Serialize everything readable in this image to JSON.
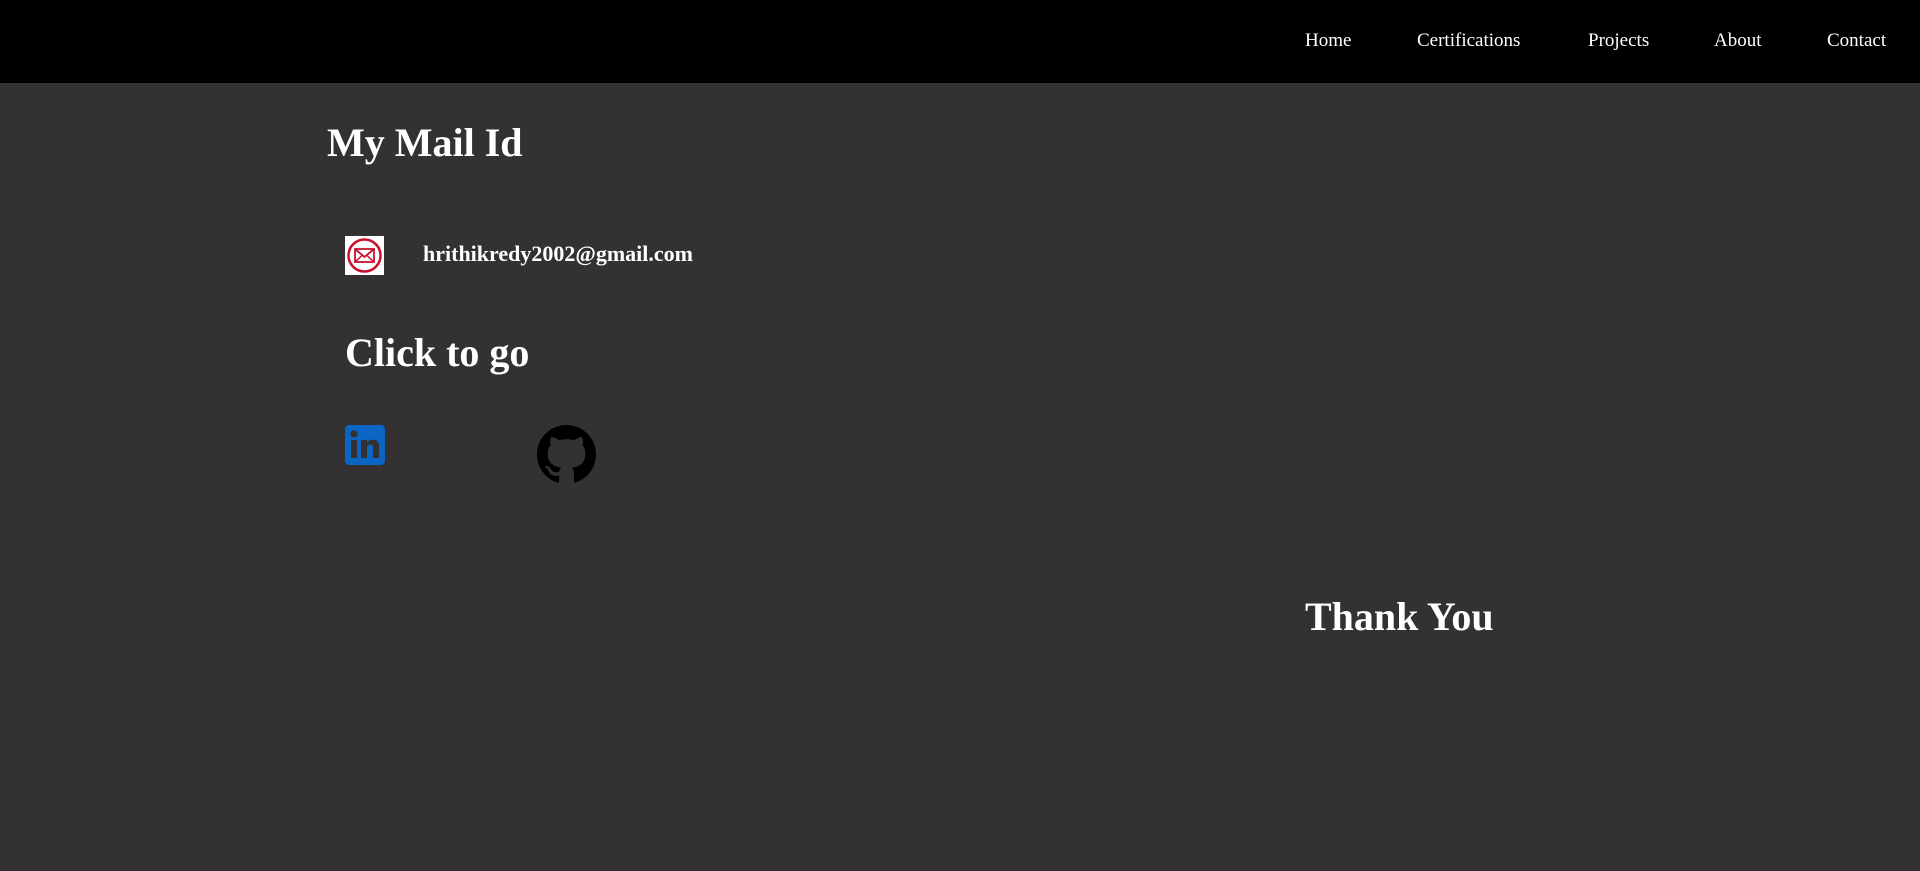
{
  "nav": {
    "items": [
      {
        "label": "Home"
      },
      {
        "label": "Certifications"
      },
      {
        "label": "Projects"
      },
      {
        "label": "About"
      },
      {
        "label": "Contact"
      }
    ]
  },
  "contact": {
    "title": "My Mail Id",
    "email": "hrithikredy2002@gmail.com",
    "mail_icon": "mail-envelope-icon"
  },
  "social": {
    "title": "Click to go",
    "links": [
      {
        "icon": "linkedin-icon",
        "color": "#0a66c2"
      },
      {
        "icon": "github-icon",
        "color": "#000000"
      }
    ]
  },
  "footer": {
    "message": "Thank You"
  },
  "colors": {
    "page_background": "#333132",
    "navbar_background": "#000000",
    "text": "#ffffff",
    "mail_icon_accent": "#c8102e"
  }
}
